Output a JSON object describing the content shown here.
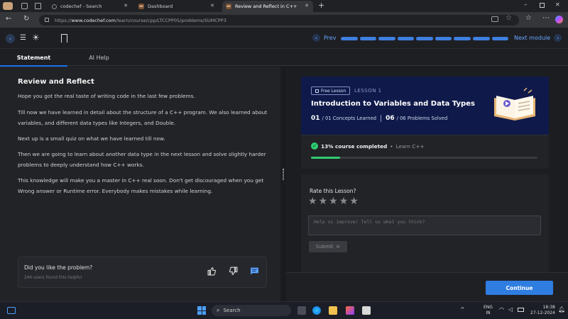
{
  "browser": {
    "tabs": [
      {
        "label": "codechef - Search",
        "active": false
      },
      {
        "label": "Dashboard",
        "active": false
      },
      {
        "label": "Review and Reflect in C++",
        "active": true
      }
    ],
    "url_prefix": "https://",
    "url_domain": "www.codechef.com",
    "url_path": "/learn/course/cpp/LTCCPP05/problems/SUMCPP3",
    "favicon_text": "cc"
  },
  "header": {
    "prev_label": "Prev",
    "next_label": "Next module",
    "progress_segments": 9
  },
  "panel_tabs": {
    "statement": "Statement",
    "ai_help": "AI Help"
  },
  "statement": {
    "title": "Review and Reflect",
    "paragraphs": [
      "Hope you got the real taste of writing code in the last few problems.",
      "Till now we have learned in detail about the structure of a C++ program. We also learned about variables, and different data types like Integers, and Double.",
      "Next up is a small quiz on what we have learned till now.",
      "Then we are going to learn about another data type in the next lesson and solve slightly harder problems to deeply understand how C++ works.",
      "This knowledge will make you a master in C++ real soon. Don't get discouraged when you get Wrong answer or Runtime error. Everybody makes mistakes while learning."
    ],
    "feedback_question": "Did you like the problem?",
    "feedback_count": "244 users found this helpful"
  },
  "lesson": {
    "badge": "Free Lesson",
    "lesson_no": "LESSON 1",
    "title": "Introduction to Variables and Data Types",
    "concepts_done": "01",
    "concepts_total": "/ 01 Concepts Learned",
    "problems_done": "06",
    "problems_total": "/ 06 Problems Solved"
  },
  "progress": {
    "percent_text": "13% course completed",
    "course": "Learn C++",
    "fraction": 0.13
  },
  "rating": {
    "label": "Rate this Lesson?",
    "stars": 5,
    "placeholder": "Help us improve! Tell us what you think?",
    "submit": "Submit"
  },
  "footer": {
    "continue": "Continue"
  },
  "taskbar": {
    "search_placeholder": "Search",
    "lang": "ENG",
    "region": "IN",
    "time": "18:38",
    "date": "27-12-2024"
  },
  "colors": {
    "accent": "#1a73e8",
    "card_bg": "#0f1a4a",
    "progress_green": "#2ecc71",
    "continue_btn": "#2f7de1"
  }
}
